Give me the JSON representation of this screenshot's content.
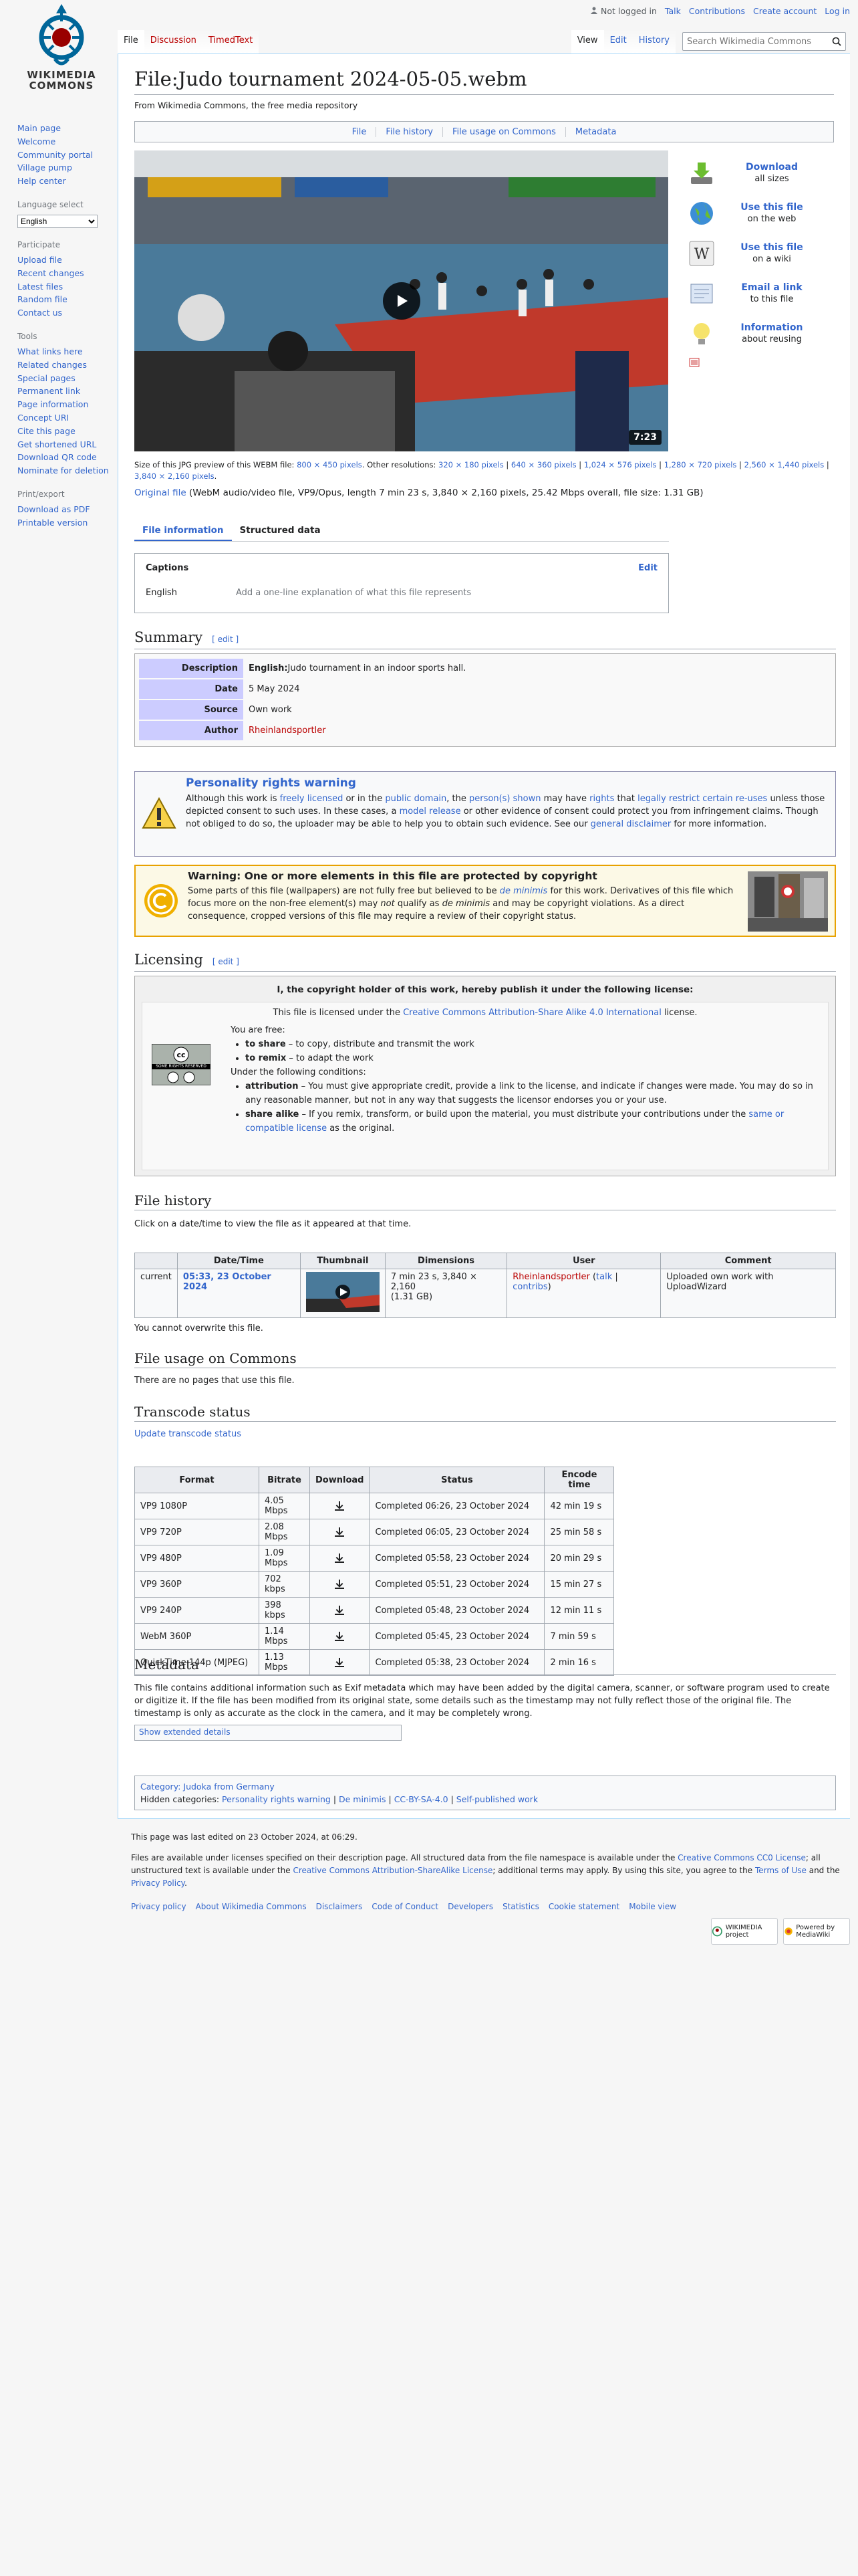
{
  "logo": {
    "line1": "WIKIMEDIA",
    "line2": "COMMONS"
  },
  "personal": {
    "not_logged": "Not logged in",
    "talk": "Talk",
    "contributions": "Contributions",
    "create": "Create account",
    "login": "Log in"
  },
  "tabs": {
    "file": "File",
    "discussion": "Discussion",
    "timedtext": "TimedText",
    "view": "View",
    "edit": "Edit",
    "history": "History"
  },
  "search": {
    "placeholder": "Search Wikimedia Commons"
  },
  "sidebar": {
    "nav": [
      "Main page",
      "Welcome",
      "Community portal",
      "Village pump",
      "Help center"
    ],
    "language_heading": "Language select",
    "language_value": "English",
    "participate_heading": "Participate",
    "participate": [
      "Upload file",
      "Recent changes",
      "Latest files",
      "Random file",
      "Contact us"
    ],
    "tools_heading": "Tools",
    "tools": [
      "What links here",
      "Related changes",
      "Special pages",
      "Permanent link",
      "Page information",
      "Concept URI",
      "Cite this page",
      "Get shortened URL",
      "Download QR code",
      "Nominate for deletion"
    ],
    "print_heading": "Print/export",
    "print": [
      "Download as PDF",
      "Printable version"
    ]
  },
  "page": {
    "title": "File:Judo tournament 2024-05-05.webm",
    "sitesub": "From Wikimedia Commons, the free media repository"
  },
  "filetoc": [
    "File",
    "File history",
    "File usage on Commons",
    "Metadata"
  ],
  "video": {
    "duration": "7:23"
  },
  "reuse": [
    {
      "title": "Download",
      "sub": "all sizes",
      "icon": "download-icon"
    },
    {
      "title": "Use this file",
      "sub": "on the web",
      "icon": "globe-icon"
    },
    {
      "title": "Use this file",
      "sub": "on a wiki",
      "icon": "wikipedia-icon"
    },
    {
      "title": "Email a link",
      "sub": "to this file",
      "icon": "email-icon"
    },
    {
      "title": "Information",
      "sub": "about reusing",
      "icon": "lightbulb-icon"
    }
  ],
  "resolutions": {
    "prefix": "Size of this JPG preview of this WEBM file:",
    "preview": "800 × 450 pixels",
    "other": ". Other resolutions:",
    "list": [
      "320 × 180 pixels",
      "640 × 360 pixels",
      "1,024 × 576 pixels",
      "1,280 × 720 pixels",
      "2,560 × 1,440 pixels",
      "3,840 × 2,160 pixels"
    ]
  },
  "original": {
    "link": "Original file",
    "desc": "(WebM audio/video file, VP9/Opus, length 7 min 23 s, 3,840 × 2,160 pixels, 25.42 Mbps overall, file size: 1.31 GB)"
  },
  "subtabs": [
    "File information",
    "Structured data"
  ],
  "captions": {
    "title": "Captions",
    "edit": "Edit",
    "lang": "English",
    "placeholder": "Add a one-line explanation of what this file represents"
  },
  "summary": {
    "heading": "Summary",
    "edit": "[ edit ]",
    "rows": [
      {
        "k": "Description",
        "v_bold": "English:",
        "v": " Judo tournament in an indoor sports hall."
      },
      {
        "k": "Date",
        "v_bold": "",
        "v": "5 May 2024"
      },
      {
        "k": "Source",
        "v_bold": "",
        "v": "Own work"
      },
      {
        "k": "Author",
        "v_bold": "",
        "v": "Rheinlandsportler"
      }
    ]
  },
  "personality": {
    "title": "Personality rights warning",
    "p1": "Although this work is ",
    "l1": "freely licensed",
    "p2": " or in the ",
    "l2": "public domain",
    "p3": ", the ",
    "l3": "person(s) shown",
    "p4": " may have ",
    "l4": "rights",
    "p5": " that ",
    "l5": "legally restrict certain re-uses",
    "p6": " unless those depicted consent to such uses. In these cases, a ",
    "l6": "model release",
    "p7": " or other evidence of consent could protect you from infringement claims. Though not obliged to do so, the uploader may be able to help you to obtain such evidence. See our ",
    "l7": "general disclaimer",
    "p8": " for more information."
  },
  "copyright": {
    "title": "Warning: One or more elements in this file are protected by copyright",
    "p1": "Some parts of this file (wallpapers) are not fully free but believed to be ",
    "l1": "de minimis",
    "p2": " for this work. Derivatives of this file which focus more on the non-free element(s) may ",
    "em1": "not",
    "p3": " qualify as ",
    "em2": "de minimis",
    "p4": " and may be copyright violations. As a direct consequence, cropped versions of this file may require a review of their copyright status."
  },
  "licensing": {
    "heading": "Licensing",
    "edit": "[ edit ]",
    "title": "I, the copyright holder of this work, hereby publish it under the following license:",
    "lic1": "This file is licensed under the ",
    "lic_link": "Creative Commons Attribution-Share Alike 4.0 International",
    "lic2": " license.",
    "free": "You are free:",
    "share_b": "to share",
    "share": " – to copy, distribute and transmit the work",
    "remix_b": "to remix",
    "remix": " – to adapt the work",
    "cond": "Under the following conditions:",
    "attr_b": "attribution",
    "attr": " – You must give appropriate credit, provide a link to the license, and indicate if changes were made. You may do so in any reasonable manner, but not in any way that suggests the licensor endorses you or your use.",
    "sa_b": "share alike",
    "sa": " – If you remix, transform, or build upon the material, you must distribute your contributions under the ",
    "sa_link": "same or compatible license",
    "sa2": " as the original.",
    "badge_text": "SOME RIGHTS RESERVED"
  },
  "history": {
    "heading": "File history",
    "intro": "Click on a date/time to view the file as it appeared at that time.",
    "headers": [
      "",
      "Date/Time",
      "Thumbnail",
      "Dimensions",
      "User",
      "Comment"
    ],
    "row": {
      "status": "current",
      "date": "05:33, 23 October 2024",
      "dims1": "7 min 23 s, 3,840 × 2,160",
      "dims2": "(1.31 GB)",
      "user": "Rheinlandsportler",
      "talk": "talk",
      "contribs": "contribs",
      "comment": "Uploaded own work with UploadWizard"
    },
    "note": "You cannot overwrite this file."
  },
  "usage": {
    "heading": "File usage on Commons",
    "text": "There are no pages that use this file."
  },
  "transcode": {
    "heading": "Transcode status",
    "update": "Update transcode status",
    "headers": [
      "Format",
      "Bitrate",
      "Download",
      "Status",
      "Encode time"
    ],
    "rows": [
      [
        "VP9 1080P",
        "4.05 Mbps",
        "Completed 06:26, 23 October 2024",
        "42 min 19 s"
      ],
      [
        "VP9 720P",
        "2.08 Mbps",
        "Completed 06:05, 23 October 2024",
        "25 min 58 s"
      ],
      [
        "VP9 480P",
        "1.09 Mbps",
        "Completed 05:58, 23 October 2024",
        "20 min 29 s"
      ],
      [
        "VP9 360P",
        "702 kbps",
        "Completed 05:51, 23 October 2024",
        "15 min 27 s"
      ],
      [
        "VP9 240P",
        "398 kbps",
        "Completed 05:48, 23 October 2024",
        "12 min 11 s"
      ],
      [
        "WebM 360P",
        "1.14 Mbps",
        "Completed 05:45, 23 October 2024",
        "7 min 59 s"
      ],
      [
        "QuickTime 144p (MJPEG)",
        "1.13 Mbps",
        "Completed 05:38, 23 October 2024",
        "2 min 16 s"
      ]
    ]
  },
  "metadata": {
    "heading": "Metadata",
    "text": "This file contains additional information such as Exif metadata which may have been added by the digital camera, scanner, or software program used to create or digitize it. If the file has been modified from its original state, some details such as the timestamp may not fully reflect those of the original file. The timestamp is only as accurate as the clock in the camera, and it may be completely wrong.",
    "show": "Show extended details"
  },
  "categories": {
    "main_label": "Category:",
    "main": "Judoka from Germany",
    "hidden_label": "Hidden categories:",
    "hidden": [
      "Personality rights warning",
      "De minimis",
      "CC-BY-SA-4.0",
      "Self-published work"
    ]
  },
  "footer": {
    "lastmod": "This page was last edited on 23 October 2024, at 06:29.",
    "l1": "Files are available under licenses specified on their description page. All structured data from the file namespace is available under the ",
    "cc0": "Creative Commons CC0 License",
    "l2": "; all unstructured text is available under the ",
    "ccbysa": "Creative Commons Attribution-ShareAlike License",
    "l3": "; additional terms may apply. By using this site, you agree to the ",
    "terms": "Terms of Use",
    "l4": " and the ",
    "privacy": "Privacy Policy",
    "l5": ".",
    "places": [
      "Privacy policy",
      "About Wikimedia Commons",
      "Disclaimers",
      "Code of Conduct",
      "Developers",
      "Statistics",
      "Cookie statement",
      "Mobile view"
    ],
    "badge1": "WIKIMEDIA project",
    "badge2": "Powered by MediaWiki"
  }
}
